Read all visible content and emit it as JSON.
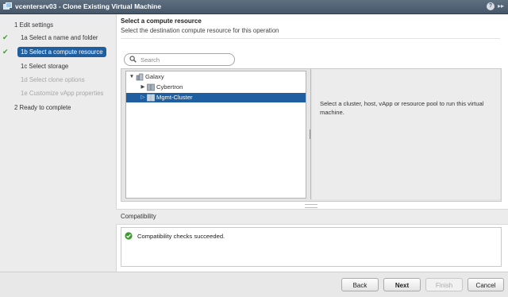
{
  "window": {
    "title": "vcentersrv03 - Clone Existing Virtual Machine",
    "help_label": "?",
    "expand_label": "▸▸"
  },
  "steps": [
    {
      "num": "1",
      "label": "1  Edit settings",
      "state": "group"
    },
    {
      "num": "1a",
      "label": "1a  Select a name and folder",
      "state": "done"
    },
    {
      "num": "1b",
      "label": "1b  Select a compute resource",
      "state": "active"
    },
    {
      "num": "1c",
      "label": "1c  Select storage",
      "state": "normal"
    },
    {
      "num": "1d",
      "label": "1d  Select clone options",
      "state": "disabled"
    },
    {
      "num": "1e",
      "label": "1e  Customize vApp properties",
      "state": "disabled"
    },
    {
      "num": "2",
      "label": "2  Ready to complete",
      "state": "normal"
    }
  ],
  "page": {
    "title": "Select a compute resource",
    "subtitle": "Select the destination compute resource for this operation"
  },
  "search": {
    "placeholder": "Search",
    "value": ""
  },
  "tree": [
    {
      "label": "Galaxy",
      "icon": "datacenter-icon",
      "expanded": true,
      "selected": false
    },
    {
      "label": "Cybertron",
      "icon": "cluster-icon",
      "expanded": false,
      "selected": false
    },
    {
      "label": "Mgmt-Cluster",
      "icon": "cluster-icon",
      "expanded": false,
      "selected": true
    }
  ],
  "info": {
    "text": "Select a cluster, host, vApp or resource pool to run this virtual machine."
  },
  "compatibility": {
    "header": "Compatibility",
    "message": "Compatibility checks succeeded.",
    "status_color": "#3c9b2d"
  },
  "buttons": {
    "back": "Back",
    "next": "Next",
    "finish": "Finish",
    "cancel": "Cancel"
  },
  "colors": {
    "accent": "#1f5f9f",
    "titlebar": "#4f6174",
    "success": "#3c9b2d"
  }
}
